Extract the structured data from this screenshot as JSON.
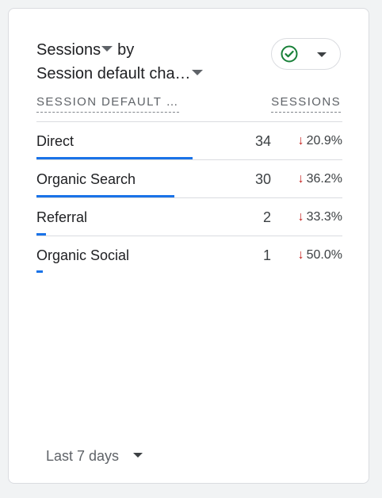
{
  "card": {
    "title_metric": "Sessions",
    "title_by": "by",
    "title_dimension": "Session default cha…",
    "compare_icon": "check-circle-icon",
    "accent_color": "#1a73e8",
    "decrease_color": "#c5221f",
    "check_color": "#188038"
  },
  "table": {
    "dimension_header": "SESSION DEFAULT …",
    "metric_header": "SESSIONS",
    "rows": [
      {
        "label": "Direct",
        "value": "34",
        "change": "20.9%",
        "share": 0.85
      },
      {
        "label": "Organic Search",
        "value": "30",
        "change": "36.2%",
        "share": 0.75
      },
      {
        "label": "Referral",
        "value": "2",
        "change": "33.3%",
        "share": 0.05
      },
      {
        "label": "Organic Social",
        "value": "1",
        "change": "50.0%",
        "share": 0.025
      }
    ]
  },
  "footer": {
    "date_range": "Last 7 days"
  }
}
